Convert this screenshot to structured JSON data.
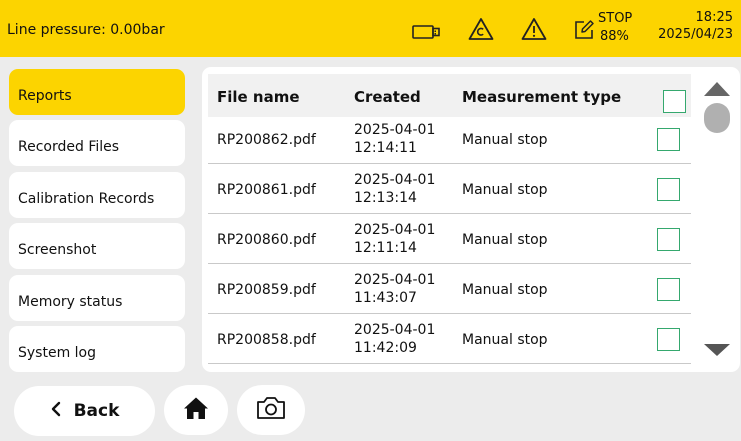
{
  "status": {
    "line_pressure": "Line pressure: 0.00bar",
    "stop_label": "STOP",
    "battery_percent": "88%",
    "time": "18:25",
    "date": "2025/04/23",
    "icons": [
      "usb-stick-icon",
      "calibration-warning-icon",
      "warning-icon",
      "edit-icon"
    ]
  },
  "sidebar": {
    "items": [
      {
        "label": "Reports",
        "active": true
      },
      {
        "label": "Recorded Files"
      },
      {
        "label": "Calibration Records"
      },
      {
        "label": "Screenshot"
      },
      {
        "label": "Memory status"
      },
      {
        "label": "System log"
      }
    ]
  },
  "table": {
    "columns": [
      "File name",
      "Created",
      "Measurement type"
    ],
    "rows": [
      {
        "file": "RP200862.pdf",
        "date": "2025-04-01",
        "time": "12:14:11",
        "type": "Manual stop"
      },
      {
        "file": "RP200861.pdf",
        "date": "2025-04-01",
        "time": "12:13:14",
        "type": "Manual stop"
      },
      {
        "file": "RP200860.pdf",
        "date": "2025-04-01",
        "time": "12:11:14",
        "type": "Manual stop"
      },
      {
        "file": "RP200859.pdf",
        "date": "2025-04-01",
        "time": "11:43:07",
        "type": "Manual stop"
      },
      {
        "file": "RP200858.pdf",
        "date": "2025-04-01",
        "time": "11:42:09",
        "type": "Manual stop"
      }
    ]
  },
  "footer": {
    "back_label": "Back",
    "icons": [
      "chevron-left-icon",
      "home-icon",
      "camera-icon"
    ]
  },
  "colors": {
    "accent": "#fcd400",
    "checkbox": "#35a86e",
    "background": "#ececec"
  }
}
